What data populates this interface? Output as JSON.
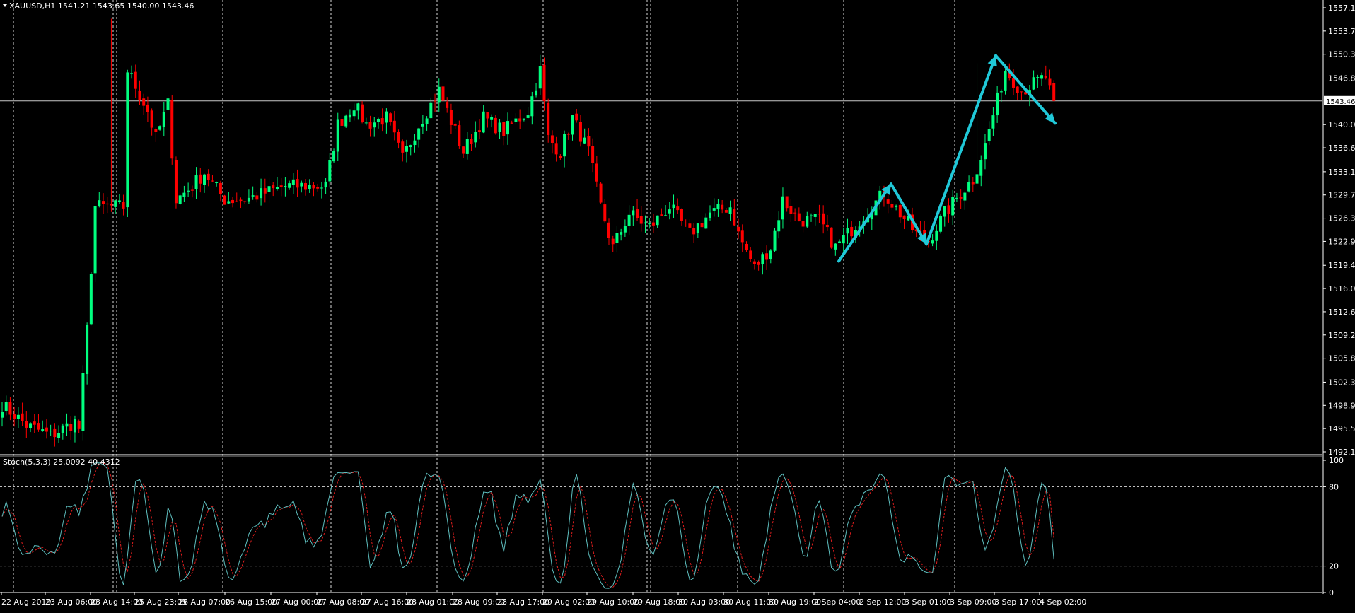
{
  "header": {
    "symbol_line": "XAUUSD,H1  1541.21 1543.65 1540.00 1543.46"
  },
  "indicator": {
    "label": "Stoch(5,3,3) 25.0092 40.4312",
    "main_color": "#5fc0c0",
    "signal_color": "#e01e1e"
  },
  "current_price_label": "1543.46",
  "colors": {
    "background": "#000000",
    "bull": "#00ff7f",
    "bear": "#ff0000",
    "grid": "#ffffff",
    "arrow": "#20c8d8"
  },
  "chart_data": [
    {
      "type": "candlestick",
      "symbol": "XAUUSD",
      "timeframe": "H1",
      "ohlc_header": [
        1541.21,
        1543.65,
        1540.0,
        1543.46
      ],
      "ylim": [
        1492.1,
        1558.0
      ],
      "y_ticks": [
        "1557.10",
        "1553.70",
        "1550.30",
        "1546.80",
        "1543.46",
        "1540.00",
        "1536.60",
        "1533.10",
        "1529.70",
        "1526.30",
        "1522.90",
        "1519.40",
        "1516.00",
        "1512.60",
        "1509.20",
        "1505.80",
        "1502.30",
        "1498.90",
        "1495.50",
        "1492.10"
      ],
      "x_ticks": [
        "22 Aug 2019",
        "23 Aug 06:00",
        "23 Aug 14:00",
        "25 Aug 23:05",
        "26 Aug 07:00",
        "26 Aug 15:00",
        "27 Aug 00:00",
        "27 Aug 08:00",
        "27 Aug 16:00",
        "28 Aug 01:00",
        "28 Aug 09:00",
        "28 Aug 17:00",
        "29 Aug 02:00",
        "29 Aug 10:00",
        "29 Aug 18:00",
        "30 Aug 03:00",
        "30 Aug 11:00",
        "30 Aug 19:00",
        "2 Sep 04:00",
        "2 Sep 12:00",
        "3 Sep 01:00",
        "3 Sep 09:00",
        "3 Sep 17:00",
        "4 Sep 02:00"
      ],
      "current_price": 1543.46,
      "anchors": [
        [
          0,
          1499.0
        ],
        [
          6,
          1496.0
        ],
        [
          12,
          1494.5
        ],
        [
          18,
          1496.5
        ],
        [
          19,
          1495.5
        ],
        [
          21,
          1510.0
        ],
        [
          23,
          1528.0
        ],
        [
          30,
          1528.0
        ],
        [
          31,
          1548.0
        ],
        [
          36,
          1542.0
        ],
        [
          38,
          1538.0
        ],
        [
          41,
          1543.0
        ],
        [
          43,
          1529.0
        ],
        [
          47,
          1531.0
        ],
        [
          50,
          1533.0
        ],
        [
          55,
          1529.0
        ],
        [
          60,
          1529.0
        ],
        [
          70,
          1531.0
        ],
        [
          80,
          1531.0
        ],
        [
          83,
          1540.0
        ],
        [
          87,
          1543.0
        ],
        [
          90,
          1540.0
        ],
        [
          95,
          1541.0
        ],
        [
          99,
          1535.0
        ],
        [
          103,
          1540.0
        ],
        [
          108,
          1545.0
        ],
        [
          114,
          1536.0
        ],
        [
          119,
          1541.0
        ],
        [
          124,
          1539.0
        ],
        [
          130,
          1542.0
        ],
        [
          133,
          1548.0
        ],
        [
          135,
          1538.0
        ],
        [
          138,
          1536.0
        ],
        [
          141,
          1541.0
        ],
        [
          145,
          1536.0
        ],
        [
          148,
          1528.0
        ],
        [
          151,
          1522.0
        ],
        [
          155,
          1527.0
        ],
        [
          160,
          1525.0
        ],
        [
          165,
          1528.0
        ],
        [
          170,
          1524.0
        ],
        [
          175,
          1527.0
        ],
        [
          180,
          1528.0
        ],
        [
          182,
          1524.0
        ],
        [
          186,
          1519.0
        ],
        [
          190,
          1522.0
        ],
        [
          193,
          1529.0
        ],
        [
          197,
          1526.0
        ],
        [
          202,
          1526.0
        ],
        [
          206,
          1522.0
        ],
        [
          212,
          1526.0
        ],
        [
          218,
          1530.0
        ],
        [
          222,
          1527.0
        ],
        [
          226,
          1524.0
        ],
        [
          229,
          1523.0
        ],
        [
          233,
          1527.0
        ],
        [
          237,
          1530.0
        ],
        [
          240,
          1532.0
        ],
        [
          243,
          1537.0
        ],
        [
          248,
          1548.0
        ],
        [
          252,
          1545.0
        ],
        [
          255,
          1546.0
        ],
        [
          258,
          1547.0
        ],
        [
          260,
          1543.0
        ]
      ],
      "stochastic": {
        "params": "5,3,3",
        "main": 25.0092,
        "signal": 40.4312,
        "ylim": [
          0,
          100
        ],
        "y_ticks": [
          "100",
          "80",
          "20",
          "0"
        ]
      }
    }
  ]
}
